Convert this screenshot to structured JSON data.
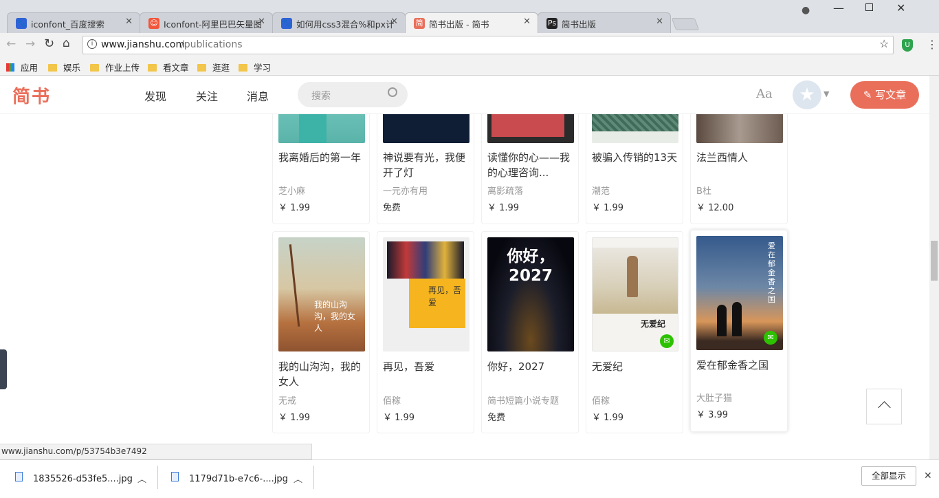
{
  "browser": {
    "tabs": [
      {
        "title": "iconfont_百度搜索",
        "favicon": "baidu-paw-icon",
        "color": "#2f62d6"
      },
      {
        "title": "Iconfont-阿里巴巴矢量图",
        "favicon": "iconfont-icon",
        "color": "#f2563b"
      },
      {
        "title": "如何用css3混合%和px计",
        "favicon": "baidu-paw-icon",
        "color": "#2f62d6"
      },
      {
        "title": "简书出版 - 简书",
        "favicon": "jianshu-icon",
        "color": "#ea6f5a"
      },
      {
        "title": "简书出版",
        "favicon": "photoshop-icon",
        "color": "#222222"
      }
    ],
    "url_domain": "www.jianshu.com",
    "url_path": "/publications",
    "bookmarks": [
      "应用",
      "娱乐",
      "作业上传",
      "看文章",
      "逛逛",
      "学习"
    ],
    "status_url": "www.jianshu.com/p/53754b3e7492",
    "downloads": [
      "1835526-d53fe5....jpg",
      "1179d71b-e7c6-....jpg"
    ],
    "show_all": "全部显示"
  },
  "site": {
    "logo": "简书",
    "nav": [
      "发现",
      "关注",
      "消息"
    ],
    "search_placeholder": "搜索",
    "font_toggle": "Aa",
    "write_button": "写文章",
    "accent": "#ea6f5a"
  },
  "books_row1": [
    {
      "title": "我离婚后的第一年",
      "author": "芝小麻",
      "price": "￥ 1.99"
    },
    {
      "title": "神说要有光，我便开了灯",
      "author": "一元亦有用",
      "price": "免费"
    },
    {
      "title": "读懂你的心——我的心理咨询...",
      "author": "离影疏落",
      "price": "￥ 1.99"
    },
    {
      "title": "被骗入传销的13天",
      "author": "潮范",
      "price": "￥ 1.99"
    },
    {
      "title": "法兰西情人",
      "author": "B杜",
      "price": "￥ 12.00"
    }
  ],
  "books_row2": [
    {
      "title": "我的山沟沟，我的女人",
      "author": "无戒",
      "price": "￥ 1.99",
      "cover_text": "我的山沟沟，我的女人"
    },
    {
      "title": "再见，吾爱",
      "author": "佰稼",
      "price": "￥ 1.99",
      "cover_text": "再见，吾爱"
    },
    {
      "title": "你好，2027",
      "author": "简书短篇小说专题",
      "price": "免费",
      "cover_text": "你好，2027"
    },
    {
      "title": "无爱纪",
      "author": "佰稼",
      "price": "￥ 1.99",
      "cover_text": "无爱纪"
    },
    {
      "title": "爱在郁金香之国",
      "author": "大肚子猫",
      "price": "￥ 3.99",
      "cover_text": "爱在郁金香之国"
    }
  ]
}
